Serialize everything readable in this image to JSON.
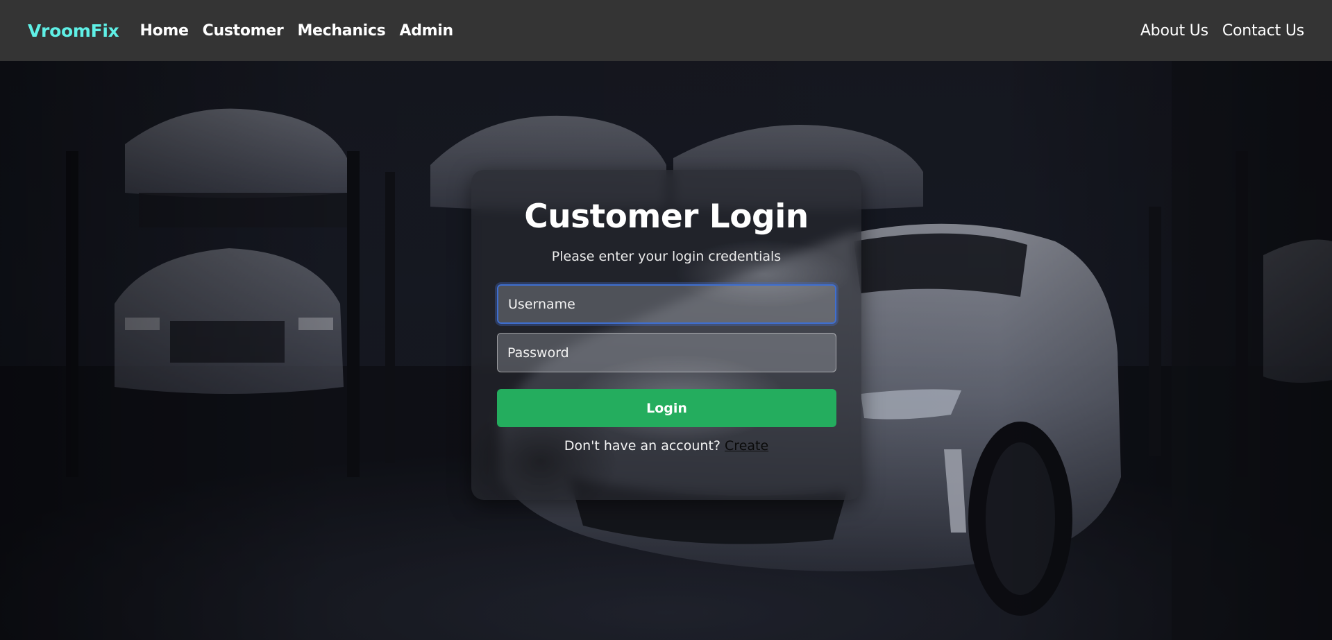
{
  "navbar": {
    "brand": "VroomFix",
    "left_links": [
      "Home",
      "Customer",
      "Mechanics",
      "Admin"
    ],
    "right_links": [
      "About Us",
      "Contact Us"
    ]
  },
  "login": {
    "title": "Customer Login",
    "subtitle": "Please enter your login credentials",
    "username_placeholder": "Username",
    "password_placeholder": "Password",
    "button_label": "Login",
    "signup_prompt": "Don't have an account?",
    "signup_link": "Create"
  },
  "colors": {
    "brand": "#5ff0e6",
    "navbar_bg": "#343434",
    "login_button": "#24ad5e",
    "focus_ring": "#3f6fd0"
  },
  "icons": {
    "background": "car-garage-photo"
  }
}
